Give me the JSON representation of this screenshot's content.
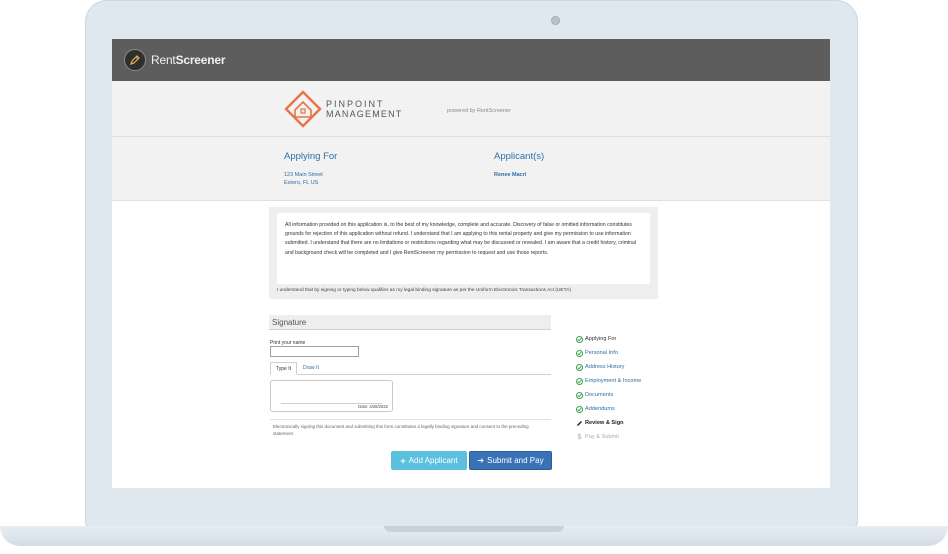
{
  "app": {
    "brand_light": "Rent",
    "brand_bold": "Screener"
  },
  "company": {
    "name_line1": "PINPOINT",
    "name_line2": "MANAGEMENT",
    "powered_by": "powered by RentScreener",
    "logo_color": "#e8734a"
  },
  "applying_for": {
    "title": "Applying For",
    "address_line1": "123 Main Street",
    "address_line2": "Estero, FL US"
  },
  "applicants": {
    "title": "Applicant(s)",
    "name": "Renee Macri"
  },
  "legal": {
    "text": "All information provided on this application is, to the best of my knowledge, complete and accurate. Discovery of false or omitted information constitutes grounds for rejection of this application without refund. I understand that I am applying to this rental property and give my permission to use information submitted. I understand that there are no limitations or restrictions regarding what may be discussed or revealed. I am aware that a credit history, criminal and background check will be completed and I give RentScreener my permission to request and use those reports.",
    "footer": "I understand that by signing or typing below qualifies as my legal binding signature as per the Uniform Electronics Transactions Act (UETA)"
  },
  "signature": {
    "heading": "Signature",
    "print_label": "Print your name",
    "print_value": "",
    "tab_type": "Type It",
    "tab_draw": "Draw It",
    "date_text": "Date: 4/28/2022",
    "disclaimer": "Electronically signing this document and submitting this form constitutes a legally binding signature and consent to the preceding statement."
  },
  "buttons": {
    "add_applicant": "Add Applicant",
    "submit_pay": "Submit and Pay"
  },
  "steps": [
    {
      "label": "Applying For",
      "state": "done"
    },
    {
      "label": "Personal Info",
      "state": "done"
    },
    {
      "label": "Address History",
      "state": "done"
    },
    {
      "label": "Employment & Income",
      "state": "done"
    },
    {
      "label": "Documents",
      "state": "done"
    },
    {
      "label": "Addendums",
      "state": "done"
    },
    {
      "label": "Review & Sign",
      "state": "current"
    },
    {
      "label": "Pay & Submit",
      "state": "pending"
    }
  ],
  "icons": {
    "brand_logo": "pencil-icon",
    "add": "plus-icon",
    "submit": "arrow-right-icon",
    "step_done": "check-circle-icon",
    "step_current": "pencil-icon",
    "step_pending": "dollar-icon"
  }
}
